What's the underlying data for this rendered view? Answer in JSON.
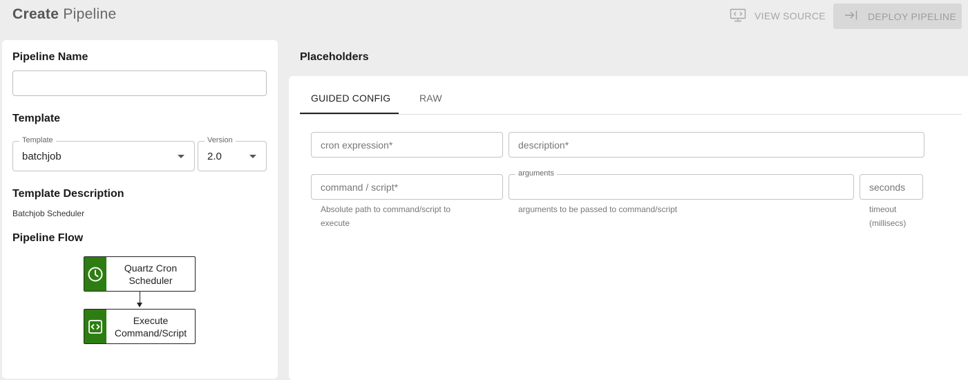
{
  "header": {
    "title_bold": "Create",
    "title_rest": "Pipeline",
    "view_source_label": "VIEW SOURCE",
    "deploy_label": "DEPLOY PIPELINE"
  },
  "left": {
    "pipeline_name_heading": "Pipeline Name",
    "pipeline_name_value": "",
    "template_heading": "Template",
    "template_select": {
      "label": "Template",
      "value": "batchjob"
    },
    "version_select": {
      "label": "Version",
      "value": "2.0"
    },
    "template_description_heading": "Template Description",
    "template_description": "Batchjob Scheduler",
    "pipeline_flow_heading": "Pipeline Flow",
    "flow": [
      {
        "label": "Quartz Cron Scheduler",
        "icon": "clock-icon"
      },
      {
        "label": "Execute Command/Script",
        "icon": "code-icon"
      }
    ]
  },
  "right": {
    "heading": "Placeholders",
    "tabs": [
      {
        "label": "GUIDED CONFIG",
        "active": true
      },
      {
        "label": "RAW",
        "active": false
      }
    ],
    "fields": {
      "cron": {
        "placeholder": "cron expression*"
      },
      "description": {
        "placeholder": "description*"
      },
      "command": {
        "placeholder": "command / script*",
        "helper": "Absolute path to command/script to execute"
      },
      "arguments": {
        "label": "arguments",
        "helper": "arguments to be passed to command/script"
      },
      "timeout": {
        "placeholder": "seconds",
        "helper": "timeout (millisecs)"
      }
    }
  },
  "colors": {
    "accent_green": "#2e7d12",
    "page_bg": "#ededed",
    "disabled_text": "#a6a6a6"
  }
}
